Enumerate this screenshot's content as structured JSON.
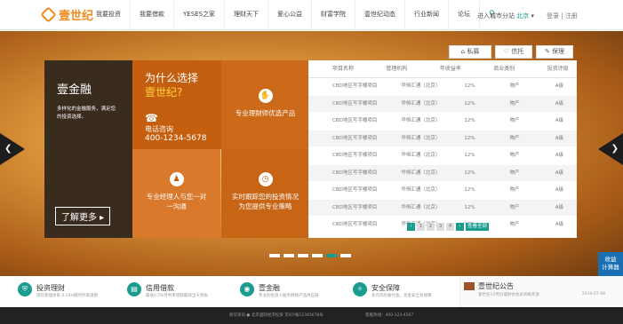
{
  "header": {
    "logo": "壹世纪",
    "nav": [
      "我要投资",
      "我要借款",
      "YESES之家",
      "理财天下",
      "爱心公益",
      "财富学院",
      "壹世纪动态",
      "行业新闻",
      "论坛"
    ],
    "city_label": "进入城市分站",
    "city_value": "北京",
    "login": "登录 | 注册"
  },
  "hero": {
    "tabs": [
      "私募",
      "信托",
      "保理"
    ],
    "panel": {
      "title": "壹金融",
      "desc": "多样化的金融服务，满足您的投资选择。",
      "more": "了解更多 ▸"
    },
    "why": {
      "line1": "为什么选择",
      "line2": "壹世纪?",
      "phone_label": "电话咨询",
      "phone": "400-1234-5678"
    },
    "cells": [
      {
        "text": "专业理财师优选产品"
      },
      {
        "text": "专业经理人与您一对一沟通"
      },
      {
        "text": "实时跟踪您的投资情况为您提供专业策略"
      }
    ],
    "table": {
      "headers": [
        "项目名称",
        "管理机构",
        "年收益率",
        "商业类别",
        "投资评级"
      ],
      "rows": [
        [
          "CBD地区写字楼项目",
          "华恒汇通（北京）",
          "12%",
          "物产",
          "A级"
        ],
        [
          "CBD地区写字楼项目",
          "华恒汇通（北京）",
          "12%",
          "物产",
          "A级"
        ],
        [
          "CBD地区写字楼项目",
          "华恒汇通（北京）",
          "12%",
          "物产",
          "A级"
        ],
        [
          "CBD地区写字楼项目",
          "华恒汇通（北京）",
          "12%",
          "物产",
          "A级"
        ],
        [
          "CBD地区写字楼项目",
          "华恒汇通（北京）",
          "12%",
          "物产",
          "A级"
        ],
        [
          "CBD地区写字楼项目",
          "华恒汇通（北京）",
          "12%",
          "物产",
          "A级"
        ],
        [
          "CBD地区写字楼项目",
          "华恒汇通（北京）",
          "12%",
          "物产",
          "A级"
        ],
        [
          "CBD地区写字楼项目",
          "华恒汇通（北京）",
          "12%",
          "物产",
          "A级"
        ],
        [
          "CBD地区写字楼项目",
          "华恒汇通（北京）",
          "12%",
          "物产",
          "A级"
        ]
      ]
    },
    "pager": [
      "‹",
      "1",
      "2",
      "3",
      "4",
      "›",
      "查看全部"
    ],
    "side_button": "收益\n计算器"
  },
  "features": [
    {
      "title": "投资理财",
      "desc": "风险管理体系 0-24H随时存取透明"
    },
    {
      "title": "信用借款",
      "desc": "最低0.5%月利率借款最快当天到账"
    },
    {
      "title": "壹金融",
      "desc": "专业的投资人服务网络产品供应链"
    },
    {
      "title": "安全保障",
      "desc": "多元风险备付金，资金安全有保障"
    }
  ],
  "notice": {
    "title": "壹世纪公告",
    "desc": "壹世纪10月份理财会会员资格开放",
    "date": "2014-07-08"
  },
  "footer": {
    "left": "新华资讯 ● 北京国际经济投资 京ICP备12345678号",
    "right": "客服热线：400-123-4567"
  }
}
